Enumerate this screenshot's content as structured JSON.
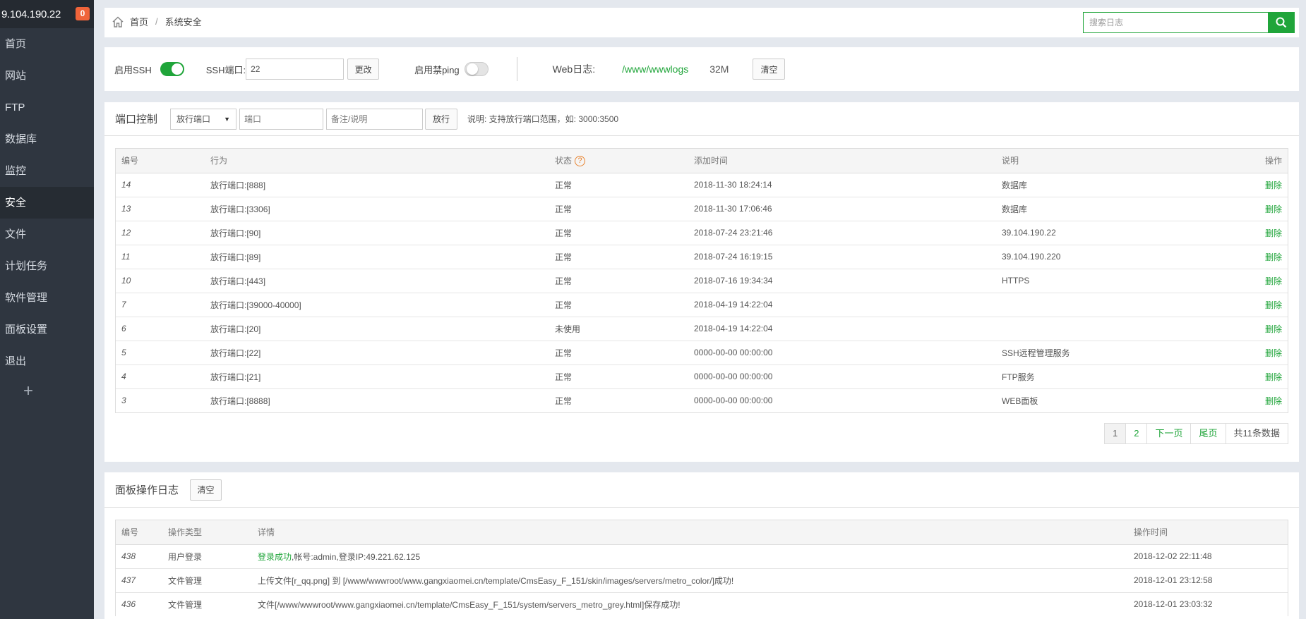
{
  "sidebar": {
    "ip": "9.104.190.22",
    "badge": "0",
    "items": [
      "首页",
      "网站",
      "FTP",
      "数据库",
      "监控",
      "安全",
      "文件",
      "计划任务",
      "软件管理",
      "面板设置",
      "退出"
    ],
    "active_index": 5,
    "add": "+"
  },
  "header": {
    "home": "首页",
    "separator": "/",
    "current": "系统安全",
    "search_placeholder": "搜索日志"
  },
  "ssh": {
    "enable_ssh_label": "启用SSH",
    "enable_ssh_on": true,
    "port_label": "SSH端口:",
    "port_value": "22",
    "change_button": "更改",
    "ping_label": "启用禁ping",
    "ping_on": false,
    "weblog_label": "Web日志:",
    "weblog_path": "/www/wwwlogs",
    "weblog_size": "32M",
    "clear_button": "清空"
  },
  "port_control": {
    "title": "端口控制",
    "select_value": "放行端口",
    "port_placeholder": "端口",
    "note_placeholder": "备注/说明",
    "submit_button": "放行",
    "hint": "说明: 支持放行端口范围，如: 3000:3500",
    "columns": [
      "编号",
      "行为",
      "状态",
      "添加时间",
      "说明",
      "操作"
    ],
    "rows": [
      [
        "14",
        "放行端口:[888]",
        "正常",
        "2018-11-30 18:24:14",
        "数据库",
        "删除"
      ],
      [
        "13",
        "放行端口:[3306]",
        "正常",
        "2018-11-30 17:06:46",
        "数据库",
        "删除"
      ],
      [
        "12",
        "放行端口:[90]",
        "正常",
        "2018-07-24 23:21:46",
        "39.104.190.22",
        "删除"
      ],
      [
        "11",
        "放行端口:[89]",
        "正常",
        "2018-07-24 16:19:15",
        "39.104.190.220",
        "删除"
      ],
      [
        "10",
        "放行端口:[443]",
        "正常",
        "2018-07-16 19:34:34",
        "HTTPS",
        "删除"
      ],
      [
        "7",
        "放行端口:[39000-40000]",
        "正常",
        "2018-04-19 14:22:04",
        "",
        "删除"
      ],
      [
        "6",
        "放行端口:[20]",
        "未使用",
        "2018-04-19 14:22:04",
        "",
        "删除"
      ],
      [
        "5",
        "放行端口:[22]",
        "正常",
        "0000-00-00 00:00:00",
        "SSH远程管理服务",
        "删除"
      ],
      [
        "4",
        "放行端口:[21]",
        "正常",
        "0000-00-00 00:00:00",
        "FTP服务",
        "删除"
      ],
      [
        "3",
        "放行端口:[8888]",
        "正常",
        "0000-00-00 00:00:00",
        "WEB面板",
        "删除"
      ]
    ],
    "pager": {
      "pages": [
        "1",
        "2"
      ],
      "current": "1",
      "next": "下一页",
      "last": "尾页",
      "total": "共11条数据"
    }
  },
  "panel_log": {
    "title": "面板操作日志",
    "clear_button": "清空",
    "columns": [
      "编号",
      "操作类型",
      "详情",
      "操作时间"
    ],
    "rows": [
      {
        "id": "438",
        "type": "用户登录",
        "detail_highlight": "登录成功",
        "detail": ",帐号:admin,登录IP:49.221.62.125",
        "time": "2018-12-02 22:11:48"
      },
      {
        "id": "437",
        "type": "文件管理",
        "detail_highlight": "",
        "detail": "上传文件[r_qq.png] 到 [/www/wwwroot/www.gangxiaomei.cn/template/CmsEasy_F_151/skin/images/servers/metro_color/]成功!",
        "time": "2018-12-01 23:12:58"
      },
      {
        "id": "436",
        "type": "文件管理",
        "detail_highlight": "",
        "detail": "文件[/www/wwwroot/www.gangxiaomei.cn/template/CmsEasy_F_151/system/servers_metro_grey.html]保存成功!",
        "time": "2018-12-01 23:03:32"
      }
    ]
  },
  "colors": {
    "accent": "#20a53a",
    "sidebar_bg": "#2f3640",
    "badge": "#f0643a"
  }
}
